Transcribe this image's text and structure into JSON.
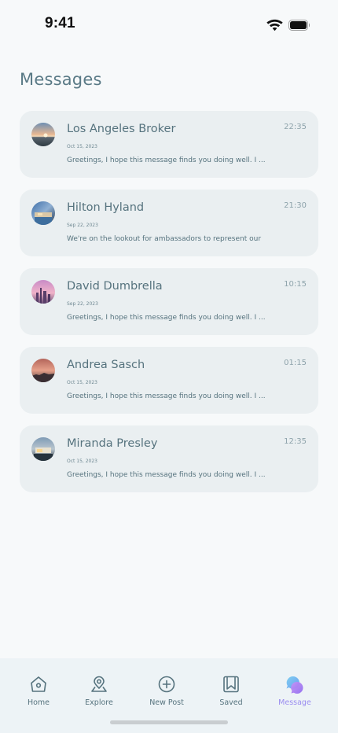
{
  "status_bar": {
    "time": "9:41"
  },
  "header": {
    "title": "Messages"
  },
  "messages": [
    {
      "name": "Los Angeles Broker",
      "date": "Oct 15, 2023",
      "time": "22:35",
      "preview": "Greetings, I hope this message finds you doing well. I ...",
      "avatar_icon": "coastal-sunset-photo"
    },
    {
      "name": "Hilton Hyland",
      "date": "Sep 22, 2023",
      "time": "21:30",
      "preview": "We're on the lookout for ambassadors to represent our",
      "avatar_icon": "house-pool-photo"
    },
    {
      "name": "David Dumbrella",
      "date": "Sep 22, 2023",
      "time": "10:15",
      "preview": "Greetings, I hope this message finds you doing well. I ...",
      "avatar_icon": "city-skyline-pink-photo"
    },
    {
      "name": "Andrea Sasch",
      "date": "Oct 15, 2023",
      "time": "01:15",
      "preview": "Greetings, I hope this message finds you doing well. I ...",
      "avatar_icon": "dusk-skyline-photo"
    },
    {
      "name": "Miranda Presley",
      "date": "Oct 15, 2023",
      "time": "12:35",
      "preview": "Greetings, I hope this message finds you doing well. I ...",
      "avatar_icon": "modern-house-photo"
    }
  ],
  "tab_bar": {
    "items": [
      {
        "label": "Home",
        "icon": "home-icon",
        "active": false
      },
      {
        "label": "Explore",
        "icon": "location-pin-icon",
        "active": false
      },
      {
        "label": "New Post",
        "icon": "plus-circle-icon",
        "active": false
      },
      {
        "label": "Saved",
        "icon": "bookmark-icon",
        "active": false
      },
      {
        "label": "Message",
        "icon": "chat-bubbles-icon",
        "active": true
      }
    ]
  },
  "colors": {
    "accent": "#9b8df0",
    "card_background": "#eaeff1",
    "text": "#56737e",
    "tab_bar_background": "#edf3f6"
  }
}
